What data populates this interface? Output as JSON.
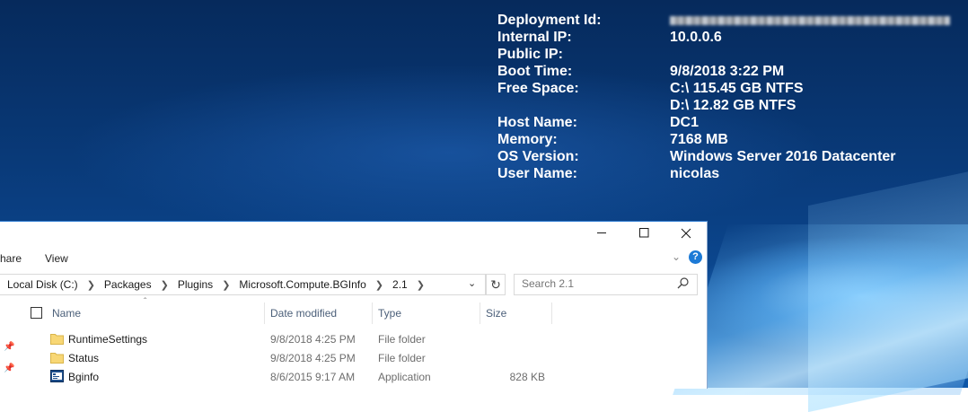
{
  "bginfo": {
    "rows": [
      {
        "label": "Deployment Id:",
        "value": ""
      },
      {
        "label": "Internal IP:",
        "value": "10.0.0.6"
      },
      {
        "label": "Public IP:",
        "value": ""
      },
      {
        "label": "Boot Time:",
        "value": "9/8/2018 3:22 PM"
      },
      {
        "label": "Free Space:",
        "value": "C:\\ 115.45 GB NTFS"
      },
      {
        "label": "",
        "value": "D:\\ 12.82 GB NTFS"
      },
      {
        "label": "Host Name:",
        "value": "DC1"
      },
      {
        "label": "Memory:",
        "value": "7168 MB"
      },
      {
        "label": "OS Version:",
        "value": "Windows Server 2016 Datacenter"
      },
      {
        "label": "User Name:",
        "value": "nicolas"
      }
    ]
  },
  "explorer": {
    "ribbon_tabs": [
      "hare",
      "View"
    ],
    "caption_icons": [
      "minimize-icon",
      "maximize-icon",
      "close-icon"
    ],
    "breadcrumbs": [
      "Local Disk (C:)",
      "Packages",
      "Plugins",
      "Microsoft.Compute.BGInfo",
      "2.1"
    ],
    "search_placeholder": "Search 2.1",
    "columns": {
      "name": "Name",
      "date": "Date modified",
      "type": "Type",
      "size": "Size"
    },
    "files": [
      {
        "name": "RuntimeSettings",
        "date": "9/8/2018 4:25 PM",
        "type": "File folder",
        "size": "",
        "icon": "folder-icon"
      },
      {
        "name": "Status",
        "date": "9/8/2018 4:25 PM",
        "type": "File folder",
        "size": "",
        "icon": "folder-icon"
      },
      {
        "name": "Bginfo",
        "date": "8/6/2015 9:17 AM",
        "type": "Application",
        "size": "828 KB",
        "icon": "application-icon"
      }
    ],
    "colors": {
      "accent": "#1c7ad6",
      "folder": "#f8d775",
      "header_text": "#4c607a"
    }
  }
}
